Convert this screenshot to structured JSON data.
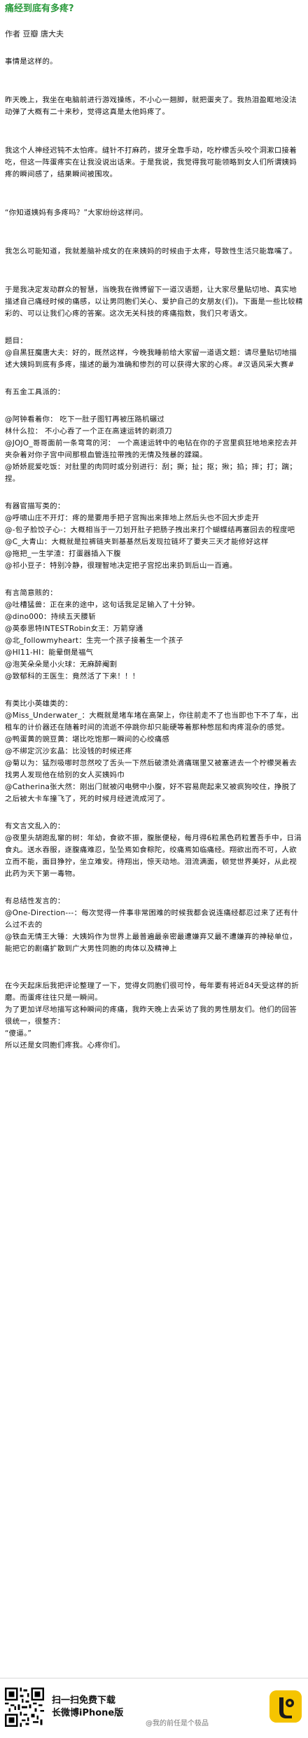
{
  "article": {
    "title": "痛经到底有多疼?",
    "byline": "作者 豆瓣 唐大夫",
    "paragraphs": [
      "事情是这样的。",
      "昨天晚上，我坐在电脑前进行游戏操练，不小心一翘脚，就把蛋夹了。我热泪盈眶地没法动弹了大概有二十来秒，觉得这真是太他妈疼了。",
      "我这个人神经迟钝不太怕疼。缝针不打麻药，拔牙全靠手动，吃柠檬舌头咬个洞漱口接着吃，但这一阵蛋疼实在让我没说出话来。于是我说，我觉得我可能领略到女人们所谓姨妈疼的瞬间感了，结果瞬间被围攻。",
      "“你知道姨妈有多疼吗？”大家纷纷这样问。",
      "我怎么可能知道，我就差脑补成女的在来姨妈的时候由于太疼，导致性生活只能靠嘴了。",
      "于是我决定发动群众的智慧，当晚我在微博留下一道汉语题，让大家尽量贴切地、真实地描述自己痛经时候的痛感，以让男同胞们关心、爱护自己的女朋友(们)。下面是一些比较精彩的、可以让我们心疼的答案。这次无关科技的疼痛指数，我们只考语文。",
      "题目：\n@自黑狂魔唐大夫：好的，既然这样，今晚我睡前给大家留一道语文题：请尽量贴切地描述大姨妈到底有多疼，描述的最为准确和惨烈的可以获得大家的心疼。#汉语风采大赛#",
      "有五金工具派的：",
      "@阿钟看着你： 吃下一肚子图钉再被压路机碾过\n林什么拉： 不小心吞了一个正在高速运转的剃须刀\n@JOJO_哥哥面前一条弯弯的河： 一个高速运转中的电钻在你的子宫里疯狂地地来挖去并夹杂着对你子宫中间那根血管连拉带拽的无情及残暴的蹂躏。\n@娇娇屁爱吃饭：对肚里的肉同时或分别进行：刮；撕；扯；抠；揪；掐；摔；打；踹；捏。",
      "有器官描写类的：\n@呼啸山庄不开灯：疼的是要用手把子宫掏出来摔地上然后头也不回大步走开\n@-包子脸饺子心-：大概相当于一刀划开肚子把肠子拽出来打个蝴蝶结再塞回去的程度吧\n@C_大青山：大概就是拉裤链夹到基基然后发现拉链坏了要夹三天才能修好这样\n@拖把_一生学渣：打蛋器插入下腹\n@祁小豆子：特别冷静，很理智地决定把子宫挖出来扔到后山一百遍。",
      "有言简意赅的：\n@吐槽猛兽：正在来的途中，这句话我足足输入了十分钟。\n@dino000：持续五天腰斩\n@英泰思特INTESTRobin女王：万箭穿通\n@北_followmyheart：生完一个孩子接着生一个孩子\n@HI11-HI：能晕倒是福气\n@泡芙朵朵是小火球：无麻醉阉割\n@致郁科的王医生：竟然活了下来！！！",
      "有类比小英雄类的：\n@Miss_Underwater_：大概就是堵车堵在高架上，你往前走不了也当即也下不了车，出租车的计价器还在随着时间的流逝不停跳你却只能硬等着那种憋屈和肉疼混杂的感觉。\n@鸭蛋黄的豌豆黄：堪比吃饱那一瞬间的心绞痛感\n@不绑定沉沙玄晶：比没钱的时候还疼\n@菊以为：猛烈吸哪时忽然咬了舌头一下然后破溃处滴痛瑞里又被塞进去一个柠檬哭着去找男人发现他在给别的女人买姨妈巾\n@Catherina张大然：刚出门就被闪电劈中小腹，好不容易爬起来又被疯狗咬住，挣脱了之后被大卡车撞飞了，死的时候月经迸流成河了。",
      "有文言文乱入的：\n@夜里头胡跑乱窜的树：年幼，食欲不振，腹胀便秘，每月得6粒黑色药粒置吾手中，日涓食丸。送水吞服，逐腹痛难忍，坠坠焉如食粽陀，绞痛焉如临痛经。翔欲出而不可，人欲立而不能，面目狰狞，坐立难安。待翔出，惊天动地。泪流满面，顿觉世界美好，从此视此药为天下第一毒物。",
      "有总结性发言的：\n@One-Direction---：每次觉得一件事非常困难的时候我都会说连痛经都忍过来了还有什么过不去的\n@铁血无情王大锤：大姨妈作为世界上最普遍最亲密最遭嫌弃又最不遭嫌弃的神秘单位，能把它的剧痛扩散到广大男性同胞的肉体以及精神上",
      "在今天起床后我把评论整理了一下，觉得女同胞们很可怜，每年要有将近84天受这样的折磨。而蛋疼往往只是一瞬间。\n为了更加详尽地描写这种瞬间的疼痛，我昨天晚上去采访了我的男性朋友们。他们的回答很统一，很整齐：\n“傻逼。”\n所以还是女同胞们疼我。心疼你们。"
    ]
  },
  "footer": {
    "promo_line1": "扫一扫免费下载",
    "promo_line2": "长微博iPhone版",
    "watermark": "@我的前任是个极品"
  },
  "colors": {
    "title": "#2a9a3c",
    "app_icon_bg": "#f5c400"
  }
}
